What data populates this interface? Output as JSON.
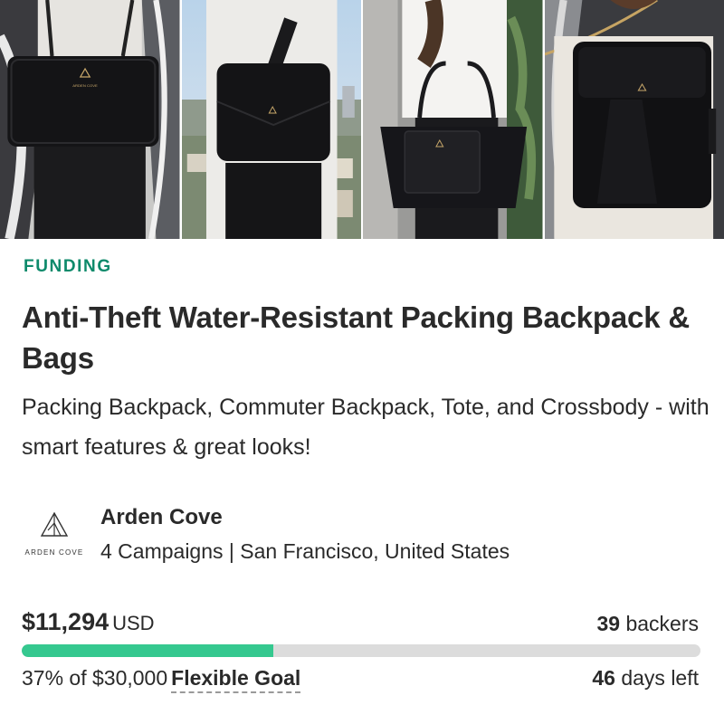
{
  "gallery": {
    "photos": [
      {
        "name": "crossbody-bag",
        "brand": "ARDEN COVE"
      },
      {
        "name": "commuter-backpack",
        "brand": "ARDEN COVE"
      },
      {
        "name": "tote-bag",
        "brand": "ARDEN COVE"
      },
      {
        "name": "packing-backpack",
        "brand": "ARDEN COVE"
      }
    ]
  },
  "campaign": {
    "status": "FUNDING",
    "title": "Anti-Theft Water-Resistant Packing Backpack & Bags",
    "subtitle": "Packing Backpack, Commuter Backpack, Tote, and Crossbody - with smart features & great looks!"
  },
  "owner": {
    "logo_text": "ARDEN COVE",
    "name": "Arden Cove",
    "meta": "4 Campaigns | San Francisco, United States"
  },
  "funding": {
    "amount": "$11,294",
    "currency": "USD",
    "backers_count": "39",
    "backers_label": "backers",
    "percent": 37,
    "goal_text": "37% of $30,000",
    "goal_type": "Flexible Goal",
    "days_count": "46",
    "days_label": "days left"
  },
  "colors": {
    "accent": "#0e8a6b",
    "progress": "#35c88f",
    "track": "#dcdcdc"
  }
}
